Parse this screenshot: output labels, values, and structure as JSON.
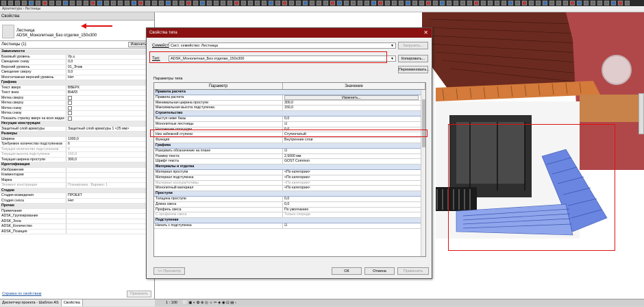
{
  "crumb": "Архитектура › Лестницы",
  "properties": {
    "header": "Свойства",
    "family": "Лестница",
    "type": "ADSK_Монолитная_Без отделки_150x300",
    "instance_filter": "Лестницы (1)",
    "edit_type": "Изменить т",
    "rows": [
      {
        "k": "Зависимости",
        "v": "",
        "grp": true
      },
      {
        "k": "Базовый уровень",
        "v": "Ур.з."
      },
      {
        "k": "Смещение снизу",
        "v": "0,0"
      },
      {
        "k": "Верхний уровень",
        "v": "01_Этаж"
      },
      {
        "k": "Смещение сверху",
        "v": "0,0"
      },
      {
        "k": "Многоэтажная верхний уровень",
        "v": "Нет"
      },
      {
        "k": "Графика",
        "v": "",
        "grp": true
      },
      {
        "k": "Текст вверх",
        "v": "ВВЕРХ"
      },
      {
        "k": "Текст вниз",
        "v": "ВНИЗ"
      },
      {
        "k": "Метка сверху",
        "v": "cb"
      },
      {
        "k": "Метка сверху",
        "v": "cb"
      },
      {
        "k": "Метка снизу",
        "v": "cb"
      },
      {
        "k": "Метка снизу",
        "v": "cb"
      },
      {
        "k": "Показать стрелку вверх на всех видах",
        "v": "cb"
      },
      {
        "k": "Несущие конструкции",
        "v": "",
        "grp": true
      },
      {
        "k": "Защитный слой арматуры",
        "v": "Защитный слой арматуры 1 <25 мм>"
      },
      {
        "k": "Размеры",
        "v": "",
        "grp": true
      },
      {
        "k": "Ширина",
        "v": "1000,0"
      },
      {
        "k": "Требуемое количество подступенков",
        "v": "6"
      },
      {
        "k": "Текущее количество подступенков",
        "v": "6",
        "gray": true
      },
      {
        "k": "Текущая высота подступенка",
        "v": "150,0",
        "gray": true
      },
      {
        "k": "Текущая ширина проступи",
        "v": "300,0"
      },
      {
        "k": "Идентификация",
        "v": "",
        "grp": true
      },
      {
        "k": "Изображение",
        "v": ""
      },
      {
        "k": "Комментарии",
        "v": ""
      },
      {
        "k": "Марка",
        "v": ""
      },
      {
        "k": "Элемент конструкции",
        "v": "Планировка : Вариант 1",
        "gray": true
      },
      {
        "k": "Стадии",
        "v": "",
        "grp": true
      },
      {
        "k": "Стадия возведения",
        "v": "ПРОЕКТ"
      },
      {
        "k": "Стадия сноса",
        "v": "Нет"
      },
      {
        "k": "Прочие",
        "v": "",
        "grp": true
      },
      {
        "k": "Примечание",
        "v": ""
      },
      {
        "k": "ADSK_Группирование",
        "v": ""
      },
      {
        "k": "ADSK_Зона",
        "v": ""
      },
      {
        "k": "ADSK_Количество",
        "v": ""
      },
      {
        "k": "ADSK_Позиция",
        "v": ""
      }
    ],
    "help_link": "Справка по свойствам",
    "apply": "Применить"
  },
  "bottom_tabs": [
    "Диспетчер проекта - Шаблон АS",
    "Свойства"
  ],
  "status": {
    "scale": "1 : 100",
    "icons": "⬜ ▣ ◐ ✿ ⊕ ◎ ☼ ✂ ◈ ◉ ⊡ ▤ ‹"
  },
  "dialog": {
    "title": "Свойства типа",
    "family_label": "Семейство:",
    "family_value": "Сист. семейство: Лестница",
    "type_label": "Тип:",
    "type_value": "ADSK_Монолитная_Без отделки_150x300",
    "load_btn": "Загрузить...",
    "copy_btn": "Копировать...",
    "rename_btn": "Переименовать...",
    "params_title": "Параметры типа",
    "col_param": "Параметр",
    "col_value": "Значение",
    "rows": [
      {
        "k": "Правила расчета",
        "v": "",
        "grp": true
      },
      {
        "k": "Правила расчета",
        "v": "Изменить...",
        "btn": true
      },
      {
        "k": "Минимальная ширина проступи",
        "v": "300,0"
      },
      {
        "k": "Максимальная высота подступенка",
        "v": "150,0"
      },
      {
        "k": "Строительство",
        "v": "",
        "grp": true
      },
      {
        "k": "Выступ ниже базы",
        "v": "0,0"
      },
      {
        "k": "Монолитные лестницы",
        "v": "☑"
      },
      {
        "k": "Наложение площадки",
        "v": "0,0"
      },
      {
        "k": "Низ забежной ступени",
        "v": "Ступенчатый"
      },
      {
        "k": "Функция",
        "v": "Внутренние слои"
      },
      {
        "k": "Графика",
        "v": "",
        "grp": true
      },
      {
        "k": "Разорвать обозначение на плане",
        "v": "☑"
      },
      {
        "k": "Размер текста",
        "v": "2,5000 мм"
      },
      {
        "k": "Шрифт текста",
        "v": "GOST Common"
      },
      {
        "k": "Материалы и отделка",
        "v": "",
        "grp": true
      },
      {
        "k": "Материал проступи",
        "v": "<По категории>"
      },
      {
        "k": "Материал подступенка",
        "v": "<По категории>"
      },
      {
        "k": "Материал косоура/тетивы",
        "v": "<По категории>",
        "gray": true
      },
      {
        "k": "Монолитный материал",
        "v": "<По категории>"
      },
      {
        "k": "Проступи",
        "v": "",
        "grp": true
      },
      {
        "k": "Толщина проступи",
        "v": "0,0"
      },
      {
        "k": "Длина свеса",
        "v": "0,0"
      },
      {
        "k": "Профиль свеса",
        "v": "По умолчанию"
      },
      {
        "k": "С профилем свеса",
        "v": "Только спереди",
        "gray": true
      },
      {
        "k": "Подступенки",
        "v": "",
        "grp": true
      },
      {
        "k": "Начать с подступенка",
        "v": "☑"
      }
    ],
    "preview_btn": "<< Просмотр",
    "ok_btn": "ОК",
    "cancel_btn": "Отмена",
    "apply_btn": "Применить"
  }
}
